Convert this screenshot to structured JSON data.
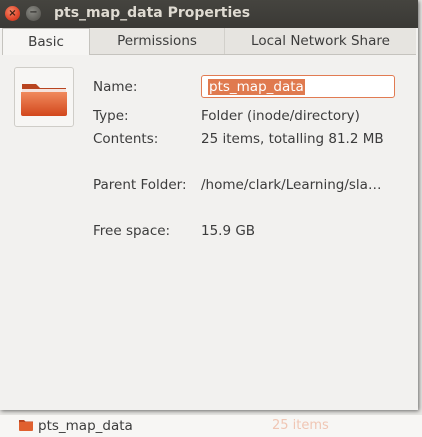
{
  "window": {
    "title": "pts_map_data Properties",
    "close_glyph": "×",
    "minimize_glyph": "−"
  },
  "tabs": [
    {
      "label": "Basic",
      "active": true
    },
    {
      "label": "Permissions",
      "active": false
    },
    {
      "label": "Local Network Share",
      "active": false
    }
  ],
  "icon": {
    "name": "folder-icon",
    "color": "#e05a2b"
  },
  "fields": {
    "name_label": "Name:",
    "name_value": "pts_map_data",
    "type_label": "Type:",
    "type_value": "Folder (inode/directory)",
    "contents_label": "Contents:",
    "contents_value": "25 items, totalling 81.2 MB",
    "parent_label": "Parent Folder:",
    "parent_value": "/home/clark/Learning/sla…",
    "free_label": "Free space:",
    "free_value": "15.9 GB"
  },
  "background_row": {
    "name": "pts_map_data",
    "items": "25 items"
  }
}
